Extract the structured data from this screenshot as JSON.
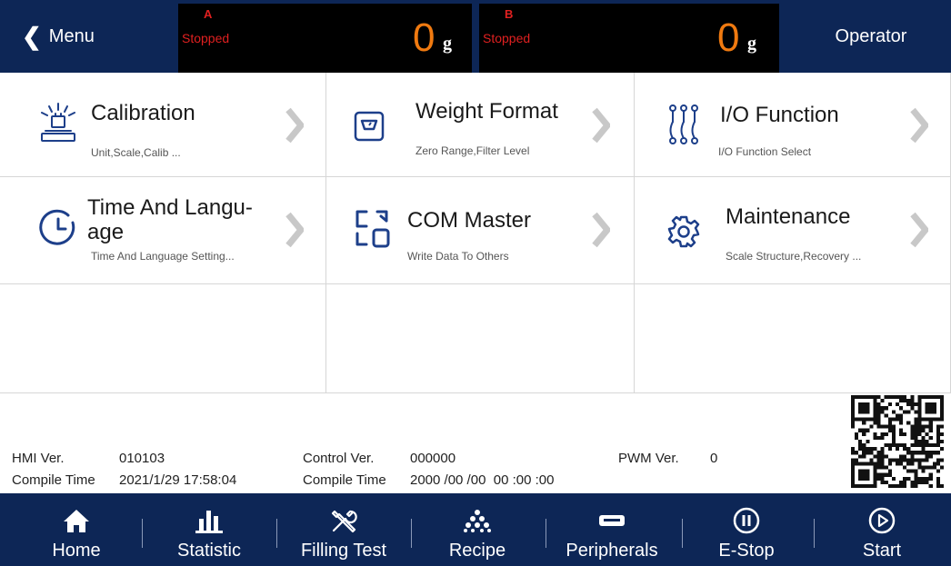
{
  "header": {
    "menu_label": "Menu",
    "operator_label": "Operator",
    "scale_a": {
      "letter": "A",
      "status": "Stopped",
      "value": "0",
      "unit": "g"
    },
    "scale_b": {
      "letter": "B",
      "status": "Stopped",
      "value": "0",
      "unit": "g"
    }
  },
  "grid": {
    "items": [
      {
        "title": "Calibration",
        "subtitle": "Unit,Scale,Calib ...",
        "icon": "calibration-weight-icon"
      },
      {
        "title": "Weight Format",
        "subtitle": "Zero Range,Filter Level",
        "icon": "scale-format-icon"
      },
      {
        "title": "I/O Function",
        "subtitle": "I/O Function Select",
        "icon": "io-function-icon"
      },
      {
        "title_line1": "Time And Langu-",
        "title_line2": "age",
        "subtitle": "Time And Language Setting...",
        "icon": "clock-icon"
      },
      {
        "title": "COM Master",
        "subtitle": "Write Data To Others",
        "icon": "com-master-icon"
      },
      {
        "title": "Maintenance",
        "subtitle": "Scale Structure,Recovery ...",
        "icon": "gear-icon"
      }
    ]
  },
  "info": {
    "hmi_ver_label": "HMI Ver.",
    "hmi_ver_value": "010103",
    "hmi_compile_label": "Compile Time",
    "hmi_compile_value": "2021/1/29 17:58:04",
    "control_ver_label": "Control Ver.",
    "control_ver_value": "000000",
    "control_compile_label": "Compile Time",
    "control_compile_value": "2000 /00 /00  00 :00 :00",
    "pwm_ver_label": "PWM Ver.",
    "pwm_ver_value": "0"
  },
  "nav": {
    "items": [
      {
        "label": "Home",
        "icon": "home-icon"
      },
      {
        "label": "Statistic",
        "icon": "bar-chart-icon"
      },
      {
        "label": "Filling Test",
        "icon": "tools-icon"
      },
      {
        "label": "Recipe",
        "icon": "recipe-dots-icon"
      },
      {
        "label": "Peripherals",
        "icon": "peripheral-device-icon"
      },
      {
        "label": "E-Stop",
        "icon": "pause-circle-icon"
      },
      {
        "label": "Start",
        "icon": "play-circle-icon"
      }
    ]
  },
  "colors": {
    "navy": "#0d2656",
    "accent_blue": "#1d3f8a",
    "status_red": "#e02020",
    "weight_orange": "#f07a10",
    "arrow_gray": "#c8c8c8"
  }
}
